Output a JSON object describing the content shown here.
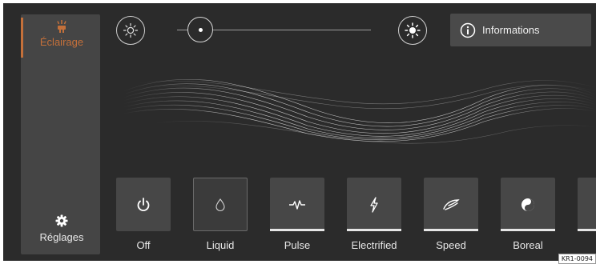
{
  "sidebar": {
    "lighting": {
      "label": "Éclairage",
      "icon": "ambient-light-icon",
      "active": true,
      "accent_color": "#c4703a"
    },
    "settings": {
      "label": "Réglages",
      "icon": "gear-icon"
    }
  },
  "brightness": {
    "low_icon": "sun-low-icon",
    "high_icon": "sun-high-icon",
    "level": 0.12
  },
  "info_button": {
    "label": "Informations",
    "icon": "info-icon"
  },
  "modes": [
    {
      "label": "Off",
      "icon": "power-icon",
      "selected": false
    },
    {
      "label": "Liquid",
      "icon": "drop-icon",
      "selected": true
    },
    {
      "label": "Pulse",
      "icon": "pulse-icon",
      "selected": false
    },
    {
      "label": "Electrified",
      "icon": "lightning-icon",
      "selected": false
    },
    {
      "label": "Speed",
      "icon": "speed-icon",
      "selected": false
    },
    {
      "label": "Boreal",
      "icon": "yin-yang-icon",
      "selected": false
    }
  ],
  "reference": "KR1-0094"
}
